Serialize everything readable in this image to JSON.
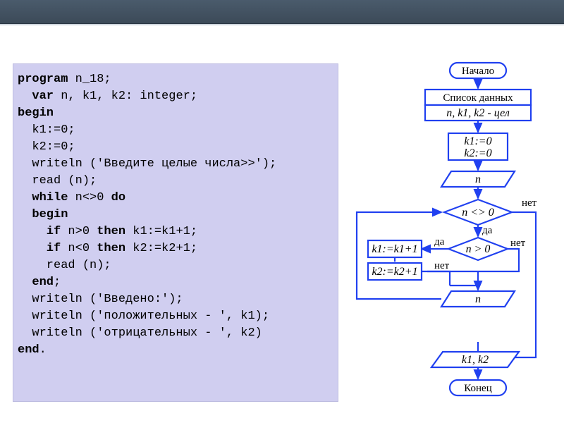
{
  "code": {
    "l1a": "program",
    "l1b": " n_18;",
    "l2a": "  var",
    "l2b": " n, k1, k2: integer;",
    "l3": "begin",
    "l4": "  k1:=0;",
    "l5": "  k2:=0;",
    "l6": "  writeln ('Введите целые числа>>');",
    "l7": "  read (n);",
    "l8a": "  while",
    "l8b": " n<>0 ",
    "l8c": "do",
    "l9": "  begin",
    "l10a": "    if",
    "l10b": " n>0 ",
    "l10c": "then",
    "l10d": " k1:=k1+1;",
    "l11a": "    if",
    "l11b": " n<0 ",
    "l11c": "then",
    "l11d": " k2:=k2+1;",
    "l12": "    read (n);",
    "l13a": "  end",
    "l13b": ";",
    "l14": "  writeln ('Введено:');",
    "l15": "  writeln ('положительных - ', k1);",
    "l16": "  writeln ('отрицательных - ', k2)",
    "l17a": "end",
    "l17b": "."
  },
  "flow": {
    "start": "Начало",
    "datalist": "Список данных",
    "vars": "n, k1, k2 - цел",
    "init1": "k1:=0",
    "init2": "k2:=0",
    "input1": "n",
    "cond1": "n <> 0",
    "cond2": "n > 0",
    "assign1": "k1:=k1+1",
    "assign2": "k2:=k2+1",
    "input2": "n",
    "output": "k1, k2",
    "end": "Конец",
    "yes": "да",
    "no": "нет"
  }
}
